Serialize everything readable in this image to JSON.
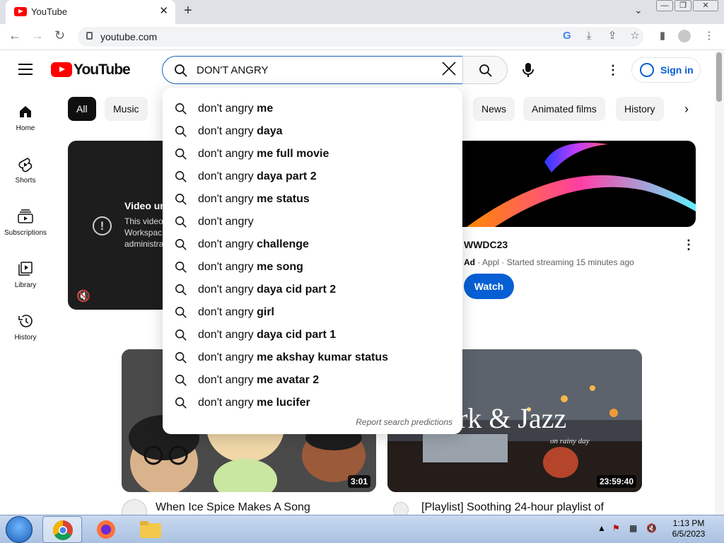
{
  "browser": {
    "tab_title": "YouTube",
    "tab_close": "✕",
    "new_tab": "+",
    "url": "youtube.com",
    "window_buttons": [
      "—",
      "❐",
      "✕"
    ]
  },
  "header": {
    "logo_text": "YouTube",
    "search_value": "DON'T ANGRY",
    "clear_glyph": "✕",
    "more_glyph": "⋮",
    "sign_in": "Sign in"
  },
  "sidebar": {
    "items": [
      {
        "label": "Home",
        "icon": "home-icon"
      },
      {
        "label": "Shorts",
        "icon": "shorts-icon"
      },
      {
        "label": "Subscriptions",
        "icon": "subscriptions-icon"
      },
      {
        "label": "Library",
        "icon": "library-icon"
      },
      {
        "label": "History",
        "icon": "history-icon"
      }
    ]
  },
  "chips": {
    "items": [
      "All",
      "Music",
      "News",
      "Animated films",
      "History"
    ],
    "next": "›"
  },
  "suggestions": [
    {
      "prefix": "don't angry ",
      "rest": "me"
    },
    {
      "prefix": "don't angry ",
      "rest": "daya"
    },
    {
      "prefix": "don't angry ",
      "rest": "me full movie"
    },
    {
      "prefix": "don't angry ",
      "rest": "daya part 2"
    },
    {
      "prefix": "don't angry ",
      "rest": "me status"
    },
    {
      "prefix": "don't angry",
      "rest": ""
    },
    {
      "prefix": "don't angry ",
      "rest": "challenge"
    },
    {
      "prefix": "don't angry ",
      "rest": "me song"
    },
    {
      "prefix": "don't angry ",
      "rest": "daya cid part 2"
    },
    {
      "prefix": "don't angry ",
      "rest": "girl"
    },
    {
      "prefix": "don't angry ",
      "rest": "daya cid part 1"
    },
    {
      "prefix": "don't angry ",
      "rest": "me akshay kumar status"
    },
    {
      "prefix": "don't angry ",
      "rest": "me avatar 2"
    },
    {
      "prefix": "don't angry ",
      "rest": "me lucifer"
    }
  ],
  "report_predictions": "Report search predictions",
  "unavailable": {
    "title": "Video un",
    "body": "This video\nWorkspac\nadministra"
  },
  "ad": {
    "title": "WWDC23",
    "badge": "Ad",
    "channel": "Appl",
    "meta": " · Started streaming 15 minutes ago",
    "cta": "Watch",
    "more": "⋮"
  },
  "videos": [
    {
      "title": "When Ice Spice Makes A Song",
      "duration": "3:01"
    },
    {
      "title": "[Playlist] Soothing 24-hour playlist of",
      "duration": "23:59:40",
      "overlay": "ork & Jazz",
      "overlay_sub": "on rainy day"
    }
  ],
  "taskbar": {
    "time": "1:13 PM",
    "date": "6/5/2023"
  },
  "colors": {
    "brand_red": "#ff0000",
    "link_blue": "#065fd4",
    "search_focus": "#1c62b9"
  }
}
